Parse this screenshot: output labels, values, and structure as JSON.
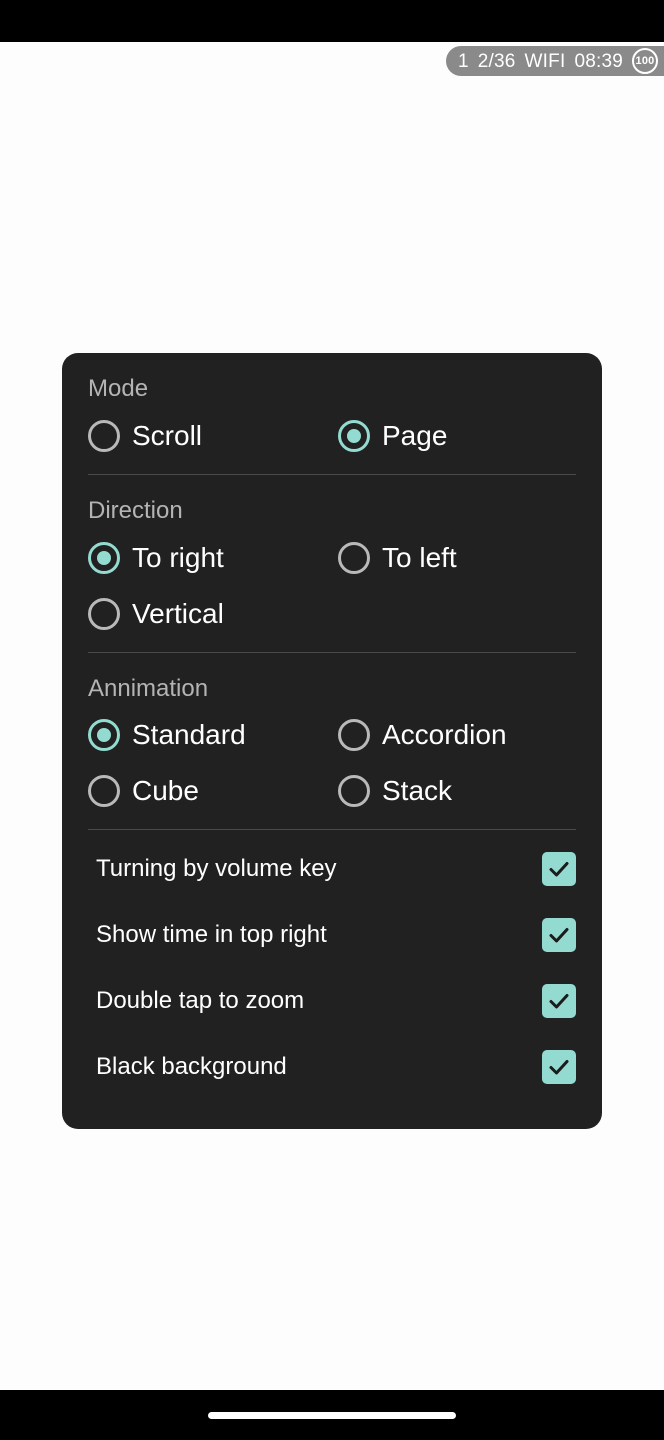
{
  "status_bar": {
    "chapter": "1",
    "page_indicator": "2/36",
    "network": "WIFI",
    "clock": "08:39",
    "battery_percent": "100",
    "battery_icon": "battery-ring-icon"
  },
  "panel": {
    "accent_color": "#93dbd0",
    "background_color": "#212121",
    "sections": [
      {
        "title": "Mode",
        "options": [
          {
            "label": "Scroll",
            "selected": false
          },
          {
            "label": "Page",
            "selected": true
          }
        ]
      },
      {
        "title": "Direction",
        "options": [
          {
            "label": "To right",
            "selected": true
          },
          {
            "label": "To left",
            "selected": false
          },
          {
            "label": "Vertical",
            "selected": false
          }
        ]
      },
      {
        "title": "Annimation",
        "options": [
          {
            "label": "Standard",
            "selected": true
          },
          {
            "label": "Accordion",
            "selected": false
          },
          {
            "label": "Cube",
            "selected": false
          },
          {
            "label": "Stack",
            "selected": false
          }
        ]
      }
    ],
    "toggles": [
      {
        "label": "Turning by volume key",
        "checked": true
      },
      {
        "label": "Show time in top right",
        "checked": true
      },
      {
        "label": "Double tap to zoom",
        "checked": true
      },
      {
        "label": "Black background",
        "checked": true
      }
    ]
  },
  "nav_bar": {
    "gesture_pill": "home-gesture-pill"
  }
}
